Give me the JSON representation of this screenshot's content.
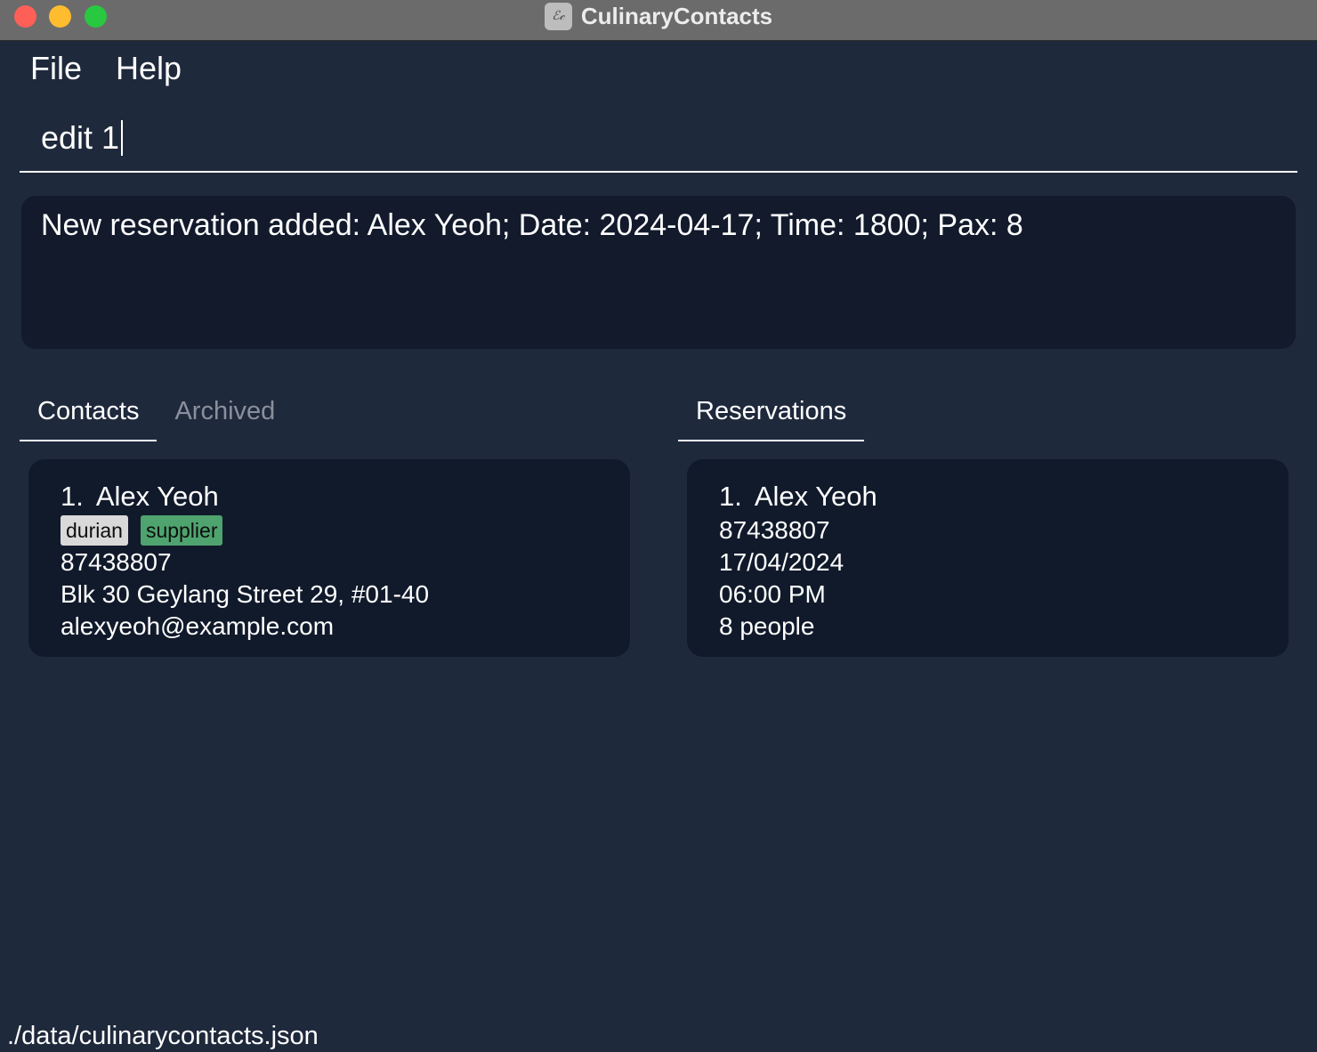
{
  "window": {
    "title": "CulinaryContacts",
    "icon_glyph": "ℰ𝒸"
  },
  "menu": {
    "items": [
      "File",
      "Help"
    ]
  },
  "command": {
    "value": "edit 1"
  },
  "result": {
    "message": "New reservation added: Alex Yeoh; Date: 2024-04-17; Time: 1800; Pax: 8"
  },
  "tabs": {
    "contacts": {
      "label": "Contacts"
    },
    "archived": {
      "label": "Archived"
    },
    "reservations": {
      "label": "Reservations"
    }
  },
  "contacts": [
    {
      "index": "1.",
      "name": "Alex Yeoh",
      "tags": [
        {
          "label": "durian",
          "color": "#d9d9d9"
        },
        {
          "label": "supplier",
          "color": "#4ea36e"
        }
      ],
      "phone": "87438807",
      "address": "Blk 30 Geylang Street 29, #01-40",
      "email": "alexyeoh@example.com"
    }
  ],
  "reservations": [
    {
      "index": "1.",
      "name": "Alex Yeoh",
      "phone": "87438807",
      "date": "17/04/2024",
      "time": "06:00 PM",
      "pax": "8 people"
    }
  ],
  "status": {
    "file_path": "./data/culinarycontacts.json"
  },
  "colors": {
    "background": "#1f293c",
    "card": "#111a2b",
    "titlebar": "#6b6b6b"
  }
}
